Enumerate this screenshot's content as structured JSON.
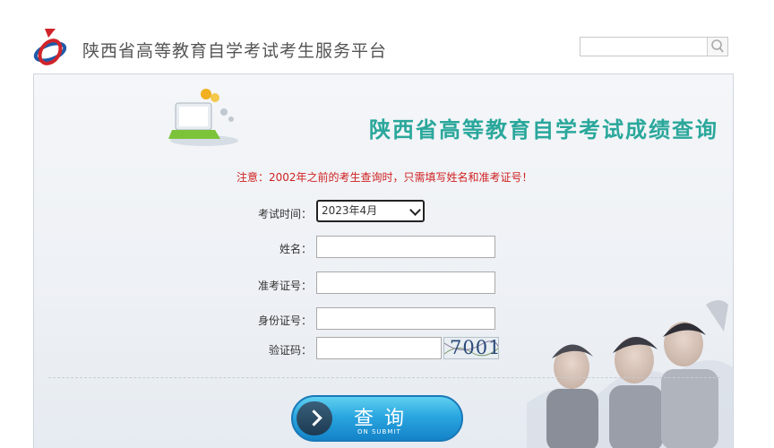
{
  "header": {
    "site_title": "陕西省高等教育自学考试考生服务平台",
    "search_placeholder": ""
  },
  "banner": {
    "title": "陕西省高等教育自学考试成绩查询"
  },
  "notice": "注意：2002年之前的考生查询时，只需填写姓名和准考证号！",
  "form": {
    "exam_time_label": "考试时间：",
    "exam_time_value": "2023年4月",
    "name_label": "姓名：",
    "name_value": "",
    "ticket_label": "准考证号：",
    "ticket_value": "",
    "id_label": "身份证号：",
    "id_value": "",
    "captcha_label": "验证码：",
    "captcha_value": "",
    "captcha_image_text": "7001"
  },
  "submit": {
    "label": "查询",
    "sublabel": "ON SUBMIT"
  },
  "colors": {
    "banner_title": "#2aa79b",
    "notice": "#d02020",
    "button": "#2aa6e0"
  }
}
